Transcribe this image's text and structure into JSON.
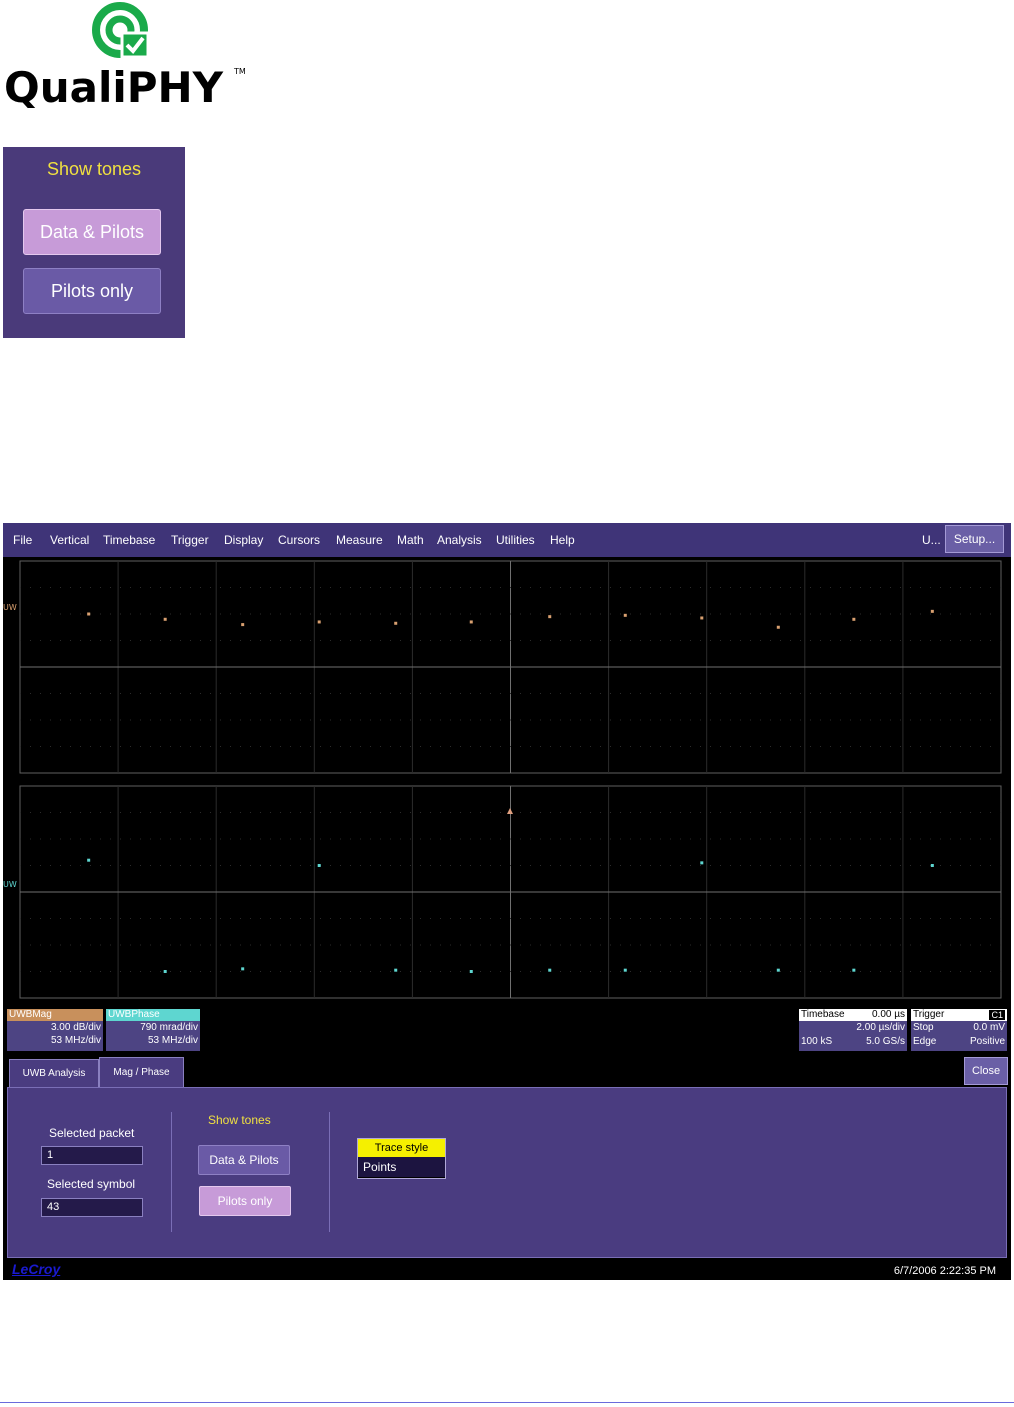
{
  "logo": {
    "name": "QualiPHY",
    "tm": "TM"
  },
  "zoom_panel": {
    "title": "Show tones",
    "data_pilots": "Data & Pilots",
    "pilots_only": "Pilots only"
  },
  "menu": {
    "items": [
      "File",
      "Vertical",
      "Timebase",
      "Trigger",
      "Display",
      "Cursors",
      "Measure",
      "Math",
      "Analysis",
      "Utilities",
      "Help"
    ],
    "u_label": "U...",
    "setup": "Setup..."
  },
  "traces": {
    "top_label": "UW",
    "bottom_label": "UW",
    "top_color": "#d9a070",
    "bottom_color": "#5ed6d0",
    "top_points_div": [
      [
        0.7,
        2.0
      ],
      [
        1.48,
        2.2
      ],
      [
        2.27,
        2.4
      ],
      [
        3.05,
        2.3
      ],
      [
        3.83,
        2.35
      ],
      [
        4.6,
        2.3
      ],
      [
        5.4,
        2.1
      ],
      [
        6.17,
        2.05
      ],
      [
        6.95,
        2.15
      ],
      [
        7.73,
        2.5
      ],
      [
        8.5,
        2.2
      ],
      [
        9.3,
        1.9
      ]
    ],
    "bottom_points_div": [
      [
        0.7,
        2.8
      ],
      [
        1.48,
        7.0
      ],
      [
        2.27,
        6.9
      ],
      [
        3.05,
        3.0
      ],
      [
        3.83,
        6.95
      ],
      [
        4.6,
        7.0
      ],
      [
        5.4,
        6.95
      ],
      [
        6.17,
        6.95
      ],
      [
        6.95,
        2.9
      ],
      [
        7.73,
        6.95
      ],
      [
        8.5,
        6.95
      ],
      [
        9.3,
        3.0
      ]
    ]
  },
  "channels": {
    "mag": {
      "name": "UWBMag",
      "line1": "3.00 dB/div",
      "line2": "53 MHz/div",
      "color": "#c8905c"
    },
    "phase": {
      "name": "UWBPhase",
      "line1": "790 mrad/div",
      "line2": "53 MHz/div",
      "color": "#5ed6d0"
    }
  },
  "timebase": {
    "title": "Timebase",
    "offset": "0.00 µs",
    "div": "2.00 µs/div",
    "samples": "100 kS",
    "rate": "5.0 GS/s"
  },
  "trigger": {
    "title": "Trigger",
    "channel": "C1",
    "mode": "Stop",
    "level": "0.0 mV",
    "type": "Edge",
    "slope": "Positive"
  },
  "tabs": {
    "analysis": "UWB Analysis",
    "magphase": "Mag / Phase",
    "close": "Close"
  },
  "panel": {
    "packet_label": "Selected packet",
    "packet_value": "1",
    "symbol_label": "Selected symbol",
    "symbol_value": "43",
    "show_tones": "Show tones",
    "data_pilots": "Data & Pilots",
    "pilots_only": "Pilots only",
    "trace_style_label": "Trace style",
    "trace_style_value": "Points"
  },
  "status": {
    "brand": "LeCroy",
    "datetime": "6/7/2006 2:22:35 PM"
  }
}
